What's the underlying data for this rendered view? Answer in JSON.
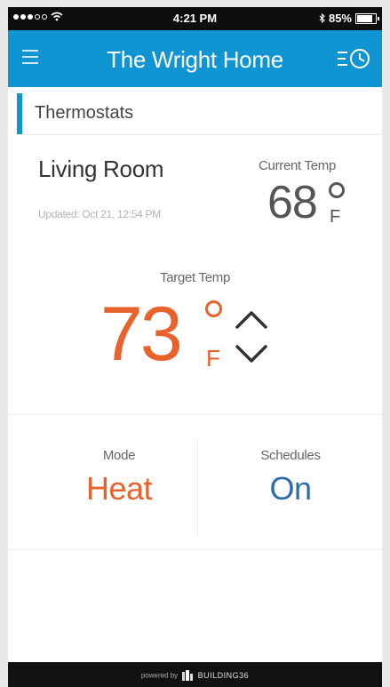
{
  "status_bar": {
    "time": "4:21 PM",
    "battery": "85%",
    "battery_level": 0.85
  },
  "header": {
    "title": "The Wright Home",
    "menu_icon": "hamburger-menu-icon",
    "schedule_icon": "schedule-clock-icon"
  },
  "section": {
    "title": "Thermostats"
  },
  "thermostat": {
    "room_name": "Living Room",
    "updated": "Updated: Oct 21, 12:54 PM",
    "current_label": "Current Temp",
    "current_temp": "68",
    "current_unit": "F",
    "target_label": "Target Temp",
    "target_temp": "73",
    "target_unit": "F"
  },
  "controls": {
    "mode_label": "Mode",
    "mode_value": "Heat",
    "schedules_label": "Schedules",
    "schedules_value": "On"
  },
  "footer": {
    "powered": "powered by",
    "brand": "BUILDING36"
  },
  "colors": {
    "accent": "#1194d2",
    "heat": "#e8622b",
    "schedule": "#2d6dae"
  }
}
